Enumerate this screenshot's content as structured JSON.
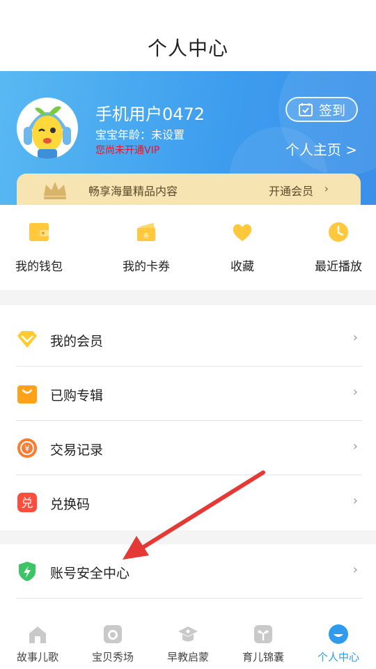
{
  "header": {
    "title": "个人中心"
  },
  "profile": {
    "username": "手机用户0472",
    "age_text": "宝宝年龄：未设置",
    "vip_status": "您尚未开通VIP",
    "signin_label": "签到",
    "homepage_label": "个人主页 >"
  },
  "vip_banner": {
    "text": "畅享海量精品内容",
    "action_label": "开通会员"
  },
  "quick_actions": [
    {
      "label": "我的钱包",
      "icon": "wallet-icon"
    },
    {
      "label": "我的卡券",
      "icon": "coupon-icon"
    },
    {
      "label": "收藏",
      "icon": "heart-icon"
    },
    {
      "label": "最近播放",
      "icon": "clock-icon"
    }
  ],
  "menu": [
    {
      "label": "我的会员",
      "icon": "vip-diamond-icon"
    },
    {
      "label": "已购专辑",
      "icon": "shopping-bag-icon"
    },
    {
      "label": "交易记录",
      "icon": "yen-coin-icon"
    },
    {
      "label": "兑换码",
      "icon": "redeem-icon"
    },
    {
      "label": "账号安全中心",
      "icon": "shield-icon"
    }
  ],
  "tabs": [
    {
      "label": "故事儿歌",
      "icon": "home-icon"
    },
    {
      "label": "宝贝秀场",
      "icon": "camera-icon"
    },
    {
      "label": "早教启蒙",
      "icon": "graduation-cap-icon"
    },
    {
      "label": "育儿锦囊",
      "icon": "sprout-icon"
    },
    {
      "label": "个人中心",
      "icon": "smile-icon",
      "active": true
    }
  ],
  "colors": {
    "accent": "#2f9bef",
    "profile_bg": "#4aa8f0",
    "vip_gold": "#f6e4b2",
    "warning_red": "#e8122b",
    "annotation_arrow": "#e53935"
  },
  "redeem_badge": "兑"
}
